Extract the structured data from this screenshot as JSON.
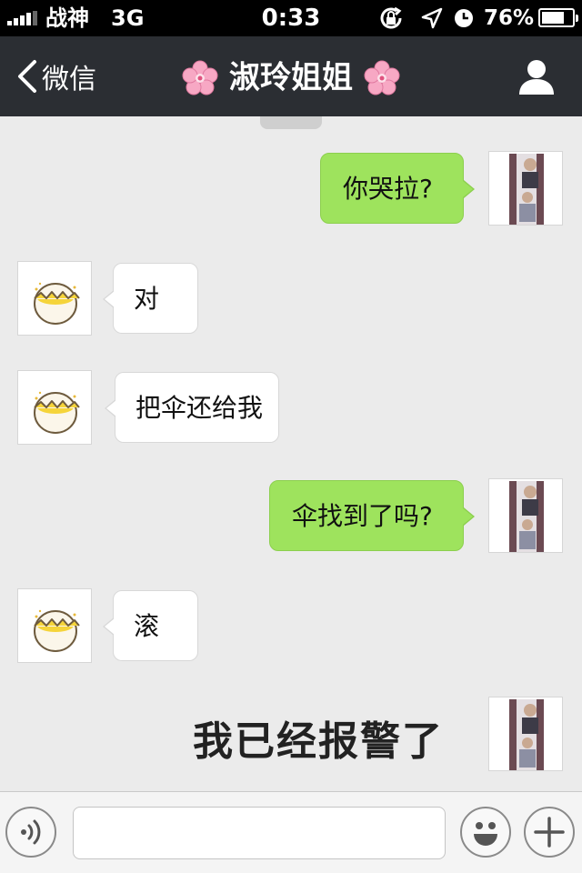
{
  "status_bar": {
    "carrier": "战神",
    "network": "3G",
    "time": "0:33",
    "battery": "76%",
    "battery_level": 0.76,
    "signal_bars": 4
  },
  "nav": {
    "back_label": "微信",
    "title": "淑玲姐姐",
    "title_decoration_icon": "cherry-blossom-icon",
    "profile_icon": "person-icon"
  },
  "chat": {
    "messages": [
      {
        "side": "out",
        "text": "你哭拉?"
      },
      {
        "side": "in",
        "text": "对"
      },
      {
        "side": "in",
        "text": "把伞还给我"
      },
      {
        "side": "out",
        "text": "伞找到了吗?"
      },
      {
        "side": "in",
        "text": "滚"
      },
      {
        "side": "out",
        "type": "sticker-text",
        "text": "我已经报警了"
      }
    ]
  },
  "input_bar": {
    "voice_icon": "voice-icon",
    "text_value": "",
    "emoji_icon": "emoji-icon",
    "plus_icon": "plus-icon"
  },
  "colors": {
    "nav_background": "#2b2e33",
    "chat_background": "#ebebeb",
    "outgoing_bubble": "#9ee35d",
    "incoming_bubble": "#ffffff"
  }
}
